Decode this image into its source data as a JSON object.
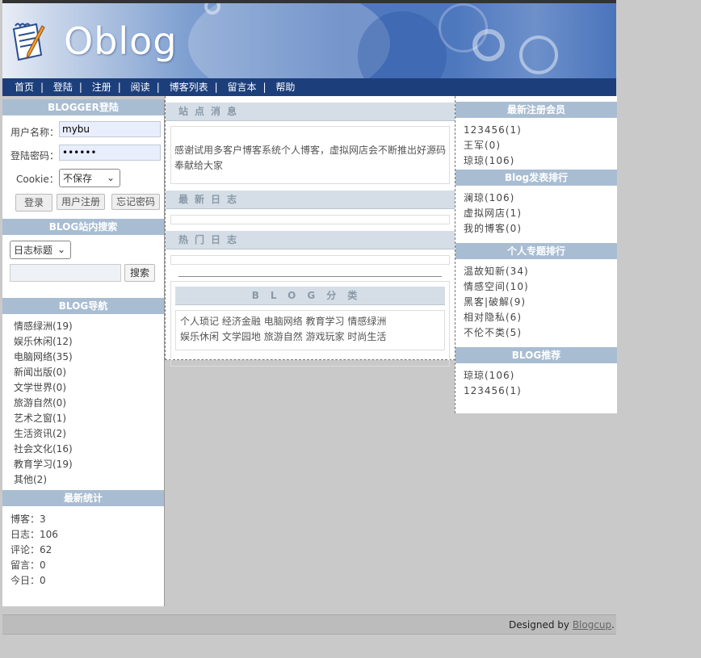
{
  "header": {
    "logo_text": "Oblog"
  },
  "nav": {
    "items": [
      "首页",
      "登陆",
      "注册",
      "阅读",
      "博客列表",
      "留言本",
      "帮助"
    ]
  },
  "login": {
    "title": "BLOGGER登陆",
    "username_label": "用户名称：",
    "username_value": "mybu",
    "password_label": "登陆密码：",
    "password_value": "••••••",
    "cookie_label": "Cookie：",
    "cookie_select": "不保存",
    "login_btn": "登录",
    "register_btn": "用户注册",
    "forgot_btn": "忘记密码"
  },
  "search": {
    "title": "BLOG站内搜索",
    "type_select": "日志标题",
    "search_btn": "搜索",
    "placeholder": ""
  },
  "blognav": {
    "title": "BLOG导航",
    "items": [
      "情感绿洲(19)",
      "娱乐休闲(12)",
      "电脑网络(35)",
      "新闻出版(0)",
      "文学世界(0)",
      "旅游自然(0)",
      "艺术之窗(1)",
      "生活资讯(2)",
      "社会文化(16)",
      "教育学习(19)",
      "其他(2)"
    ]
  },
  "stats": {
    "title": "最新统计",
    "items": [
      "博客：3",
      "日志：106",
      "评论：62",
      "留言：0",
      "今日：0"
    ]
  },
  "center": {
    "news_title": "站点消息",
    "news_text": "感谢试用多客户博客系统个人博客，虚拟网店会不断推出好源码奉献给大家",
    "latest_title": "最新日志",
    "hot_title": "热门日志",
    "category_title": "BLOG分类",
    "categories_row1": [
      "个人琐记",
      "经济金融",
      "电脑网络",
      "教育学习",
      "情感绿洲"
    ],
    "categories_row2": [
      "娱乐休闲",
      "文学园地",
      "旅游自然",
      "游戏玩家",
      "时尚生活"
    ]
  },
  "right": {
    "new_members_title": "最新注册会员",
    "new_members": [
      "123456(1)",
      "王军(0)",
      "琼琼(106)"
    ],
    "rank_title": "Blog发表排行",
    "rank": [
      "澜琼(106)",
      "虚拟网店(1)",
      "我的博客(0)"
    ],
    "topic_title": "个人专题排行",
    "topics": [
      "温故知新(34)",
      "情感空间(10)",
      "黑客|破解(9)",
      "相对隐私(6)",
      "不伦不类(5)"
    ],
    "recommend_title": "BLOG推荐",
    "recommend": [
      "琼琼(106)",
      "123456(1)"
    ]
  },
  "footer": {
    "designed_by": "Designed by ",
    "link": "Blogcup",
    "dot": "."
  }
}
